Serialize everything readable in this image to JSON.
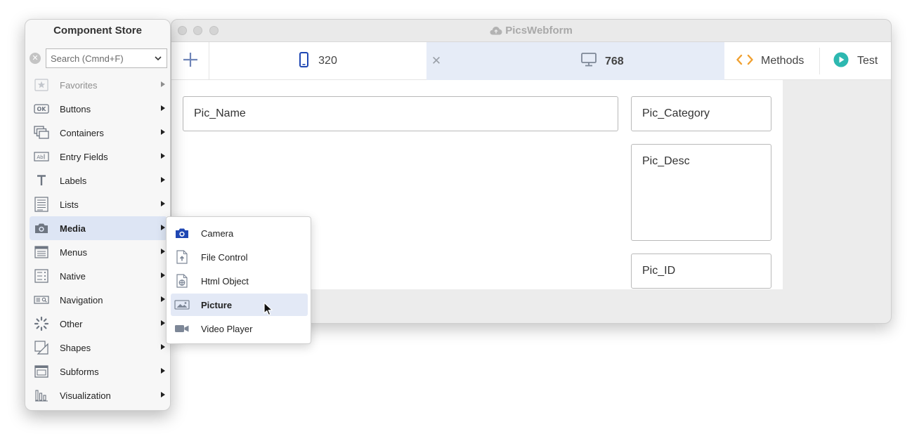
{
  "window": {
    "title": "PicsWebform",
    "cloud_icon": "cloud-icon"
  },
  "toolbar": {
    "add_icon": "plus-icon",
    "tabs": [
      {
        "label": "320",
        "icon": "mobile-phone-icon",
        "active": false
      },
      {
        "label": "768",
        "icon": "desktop-monitor-icon",
        "active": true,
        "close_icon": "close-icon"
      }
    ],
    "methods_label": "Methods",
    "methods_icon": "code-brackets-icon",
    "test_label": "Test",
    "test_icon": "play-circle-icon",
    "accent_color": "#f0a030",
    "play_color": "#2db8b0",
    "active_tab_color": "#e6ecf7"
  },
  "form": {
    "fields": [
      {
        "label": "Pic_Name"
      },
      {
        "label": "Pic_Category"
      },
      {
        "label": "Pic_Desc"
      },
      {
        "label": "Pic_ID"
      }
    ]
  },
  "palette": {
    "title": "Component Store",
    "search_placeholder": "Search (Cmnd+F)",
    "items": [
      {
        "label": "Favorites",
        "icon": "star-icon",
        "muted": true
      },
      {
        "label": "Buttons",
        "icon": "ok-button-icon"
      },
      {
        "label": "Containers",
        "icon": "stacked-windows-icon"
      },
      {
        "label": "Entry Fields",
        "icon": "text-field-icon"
      },
      {
        "label": "Labels",
        "icon": "text-t-icon"
      },
      {
        "label": "Lists",
        "icon": "list-icon"
      },
      {
        "label": "Media",
        "icon": "camera-icon",
        "selected": true
      },
      {
        "label": "Menus",
        "icon": "menu-icon"
      },
      {
        "label": "Native",
        "icon": "native-list-icon"
      },
      {
        "label": "Navigation",
        "icon": "search-box-icon"
      },
      {
        "label": "Other",
        "icon": "spinner-icon"
      },
      {
        "label": "Shapes",
        "icon": "shapes-icon"
      },
      {
        "label": "Subforms",
        "icon": "subform-icon"
      },
      {
        "label": "Visualization",
        "icon": "bar-chart-icon"
      }
    ]
  },
  "submenu": {
    "items": [
      {
        "label": "Camera",
        "icon": "camera-icon"
      },
      {
        "label": "File Control",
        "icon": "file-upload-icon"
      },
      {
        "label": "Html Object",
        "icon": "html-globe-icon"
      },
      {
        "label": "Picture",
        "icon": "picture-icon",
        "hover": true
      },
      {
        "label": "Video Player",
        "icon": "video-camera-icon"
      }
    ]
  }
}
